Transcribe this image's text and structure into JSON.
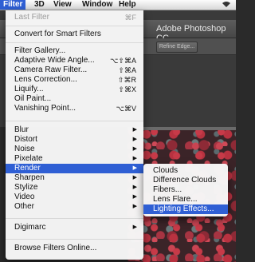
{
  "menubar": {
    "items": [
      "Filter",
      "3D",
      "View",
      "Window",
      "Help"
    ],
    "right_icon": "wifi-icon"
  },
  "app": {
    "title": "Adobe Photoshop CC",
    "refine_button": "Refine Edge..."
  },
  "filter_menu": {
    "last_filter": {
      "label": "Last Filter",
      "shortcut": "⌘F"
    },
    "convert": {
      "label": "Convert for Smart Filters"
    },
    "gallery": {
      "label": "Filter Gallery..."
    },
    "adaptive": {
      "label": "Adaptive Wide Angle...",
      "shortcut": "⌥⇧⌘A"
    },
    "camera_raw": {
      "label": "Camera Raw Filter...",
      "shortcut": "⇧⌘A"
    },
    "lens_correction": {
      "label": "Lens Correction...",
      "shortcut": "⇧⌘R"
    },
    "liquify": {
      "label": "Liquify...",
      "shortcut": "⇧⌘X"
    },
    "oil_paint": {
      "label": "Oil Paint..."
    },
    "vanishing": {
      "label": "Vanishing Point...",
      "shortcut": "⌥⌘V"
    },
    "blur": {
      "label": "Blur"
    },
    "distort": {
      "label": "Distort"
    },
    "noise": {
      "label": "Noise"
    },
    "pixelate": {
      "label": "Pixelate"
    },
    "render": {
      "label": "Render"
    },
    "sharpen": {
      "label": "Sharpen"
    },
    "stylize": {
      "label": "Stylize"
    },
    "video": {
      "label": "Video"
    },
    "other": {
      "label": "Other"
    },
    "digimarc": {
      "label": "Digimarc"
    },
    "browse": {
      "label": "Browse Filters Online..."
    }
  },
  "render_submenu": {
    "items": [
      "Clouds",
      "Difference Clouds",
      "Fibers...",
      "Lens Flare...",
      "Lighting Effects..."
    ]
  }
}
